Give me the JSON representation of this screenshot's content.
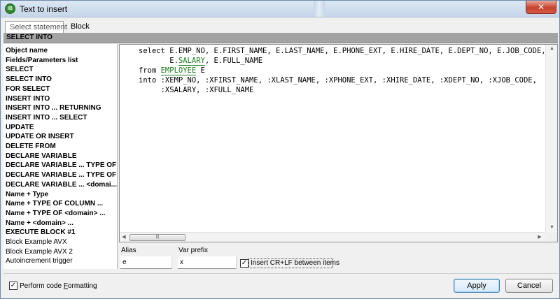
{
  "window": {
    "title": "Text to insert",
    "close_symbol": "✕",
    "app_icon_text": "IB"
  },
  "tabs": [
    {
      "label": "Select statement",
      "active": true
    },
    {
      "label": "Block",
      "active": false
    }
  ],
  "section_header": "SELECT INTO",
  "left_list": [
    {
      "label": "Object name",
      "bold": true
    },
    {
      "label": "Fields/Parameters list",
      "bold": true
    },
    {
      "label": "SELECT",
      "bold": true
    },
    {
      "label": "SELECT INTO",
      "bold": true
    },
    {
      "label": "FOR SELECT",
      "bold": true
    },
    {
      "label": "INSERT INTO",
      "bold": true
    },
    {
      "label": "INSERT INTO ... RETURNING",
      "bold": true
    },
    {
      "label": "INSERT INTO ... SELECT",
      "bold": true
    },
    {
      "label": "UPDATE",
      "bold": true
    },
    {
      "label": "UPDATE OR INSERT",
      "bold": true
    },
    {
      "label": "DELETE FROM",
      "bold": true
    },
    {
      "label": "DECLARE VARIABLE",
      "bold": true
    },
    {
      "label": "DECLARE VARIABLE ... TYPE OF ...",
      "bold": true
    },
    {
      "label": "DECLARE VARIABLE ... TYPE OF ...",
      "bold": true
    },
    {
      "label": "DECLARE VARIABLE ... <domai...",
      "bold": true
    },
    {
      "label": "Name + Type",
      "bold": true
    },
    {
      "label": "Name + TYPE OF COLUMN ...",
      "bold": true
    },
    {
      "label": "Name + TYPE OF <domain> ...",
      "bold": true
    },
    {
      "label": "Name + <domain> ...",
      "bold": true
    },
    {
      "label": "EXECUTE BLOCK #1",
      "bold": true
    },
    {
      "label": "Block Example AVX",
      "bold": false
    },
    {
      "label": "Block Example AVX 2",
      "bold": false
    },
    {
      "label": "Autoincrement trigger",
      "bold": false
    }
  ],
  "code": {
    "line1": "select E.EMP_NO, E.FIRST_NAME, E.LAST_NAME, E.PHONE_EXT, E.HIRE_DATE, E.DEPT_NO, E.JOB_CODE,",
    "line2_indent": "       E.",
    "line2_ident": "SALARY",
    "line2_rest": ", E.FULL_NAME",
    "line3_kw": "from ",
    "line3_ident": "EMPLOYEE",
    "line3_rest": " E",
    "line4": "into :XEMP_NO, :XFIRST_NAME, :XLAST_NAME, :XPHONE_EXT, :XHIRE_DATE, :XDEPT_NO, :XJOB_CODE,",
    "line5": "     :XSALARY, :XFULL_NAME"
  },
  "scroll": {
    "thumb_grip": "|||",
    "left": "◀",
    "right": "▶",
    "up": "▲",
    "down": "▼"
  },
  "fields": {
    "alias_label": "Alias",
    "alias_value": "e",
    "prefix_label": "Var prefix",
    "prefix_value": "x"
  },
  "options": {
    "cr_lf_label": "Insert CR+LF between items",
    "cr_lf_checked": true,
    "format_label_pre": "Perform code ",
    "format_label_u": "F",
    "format_label_post": "ormatting",
    "format_checked": true,
    "check_mark": "✓"
  },
  "buttons": {
    "apply": "Apply",
    "cancel": "Cancel"
  }
}
